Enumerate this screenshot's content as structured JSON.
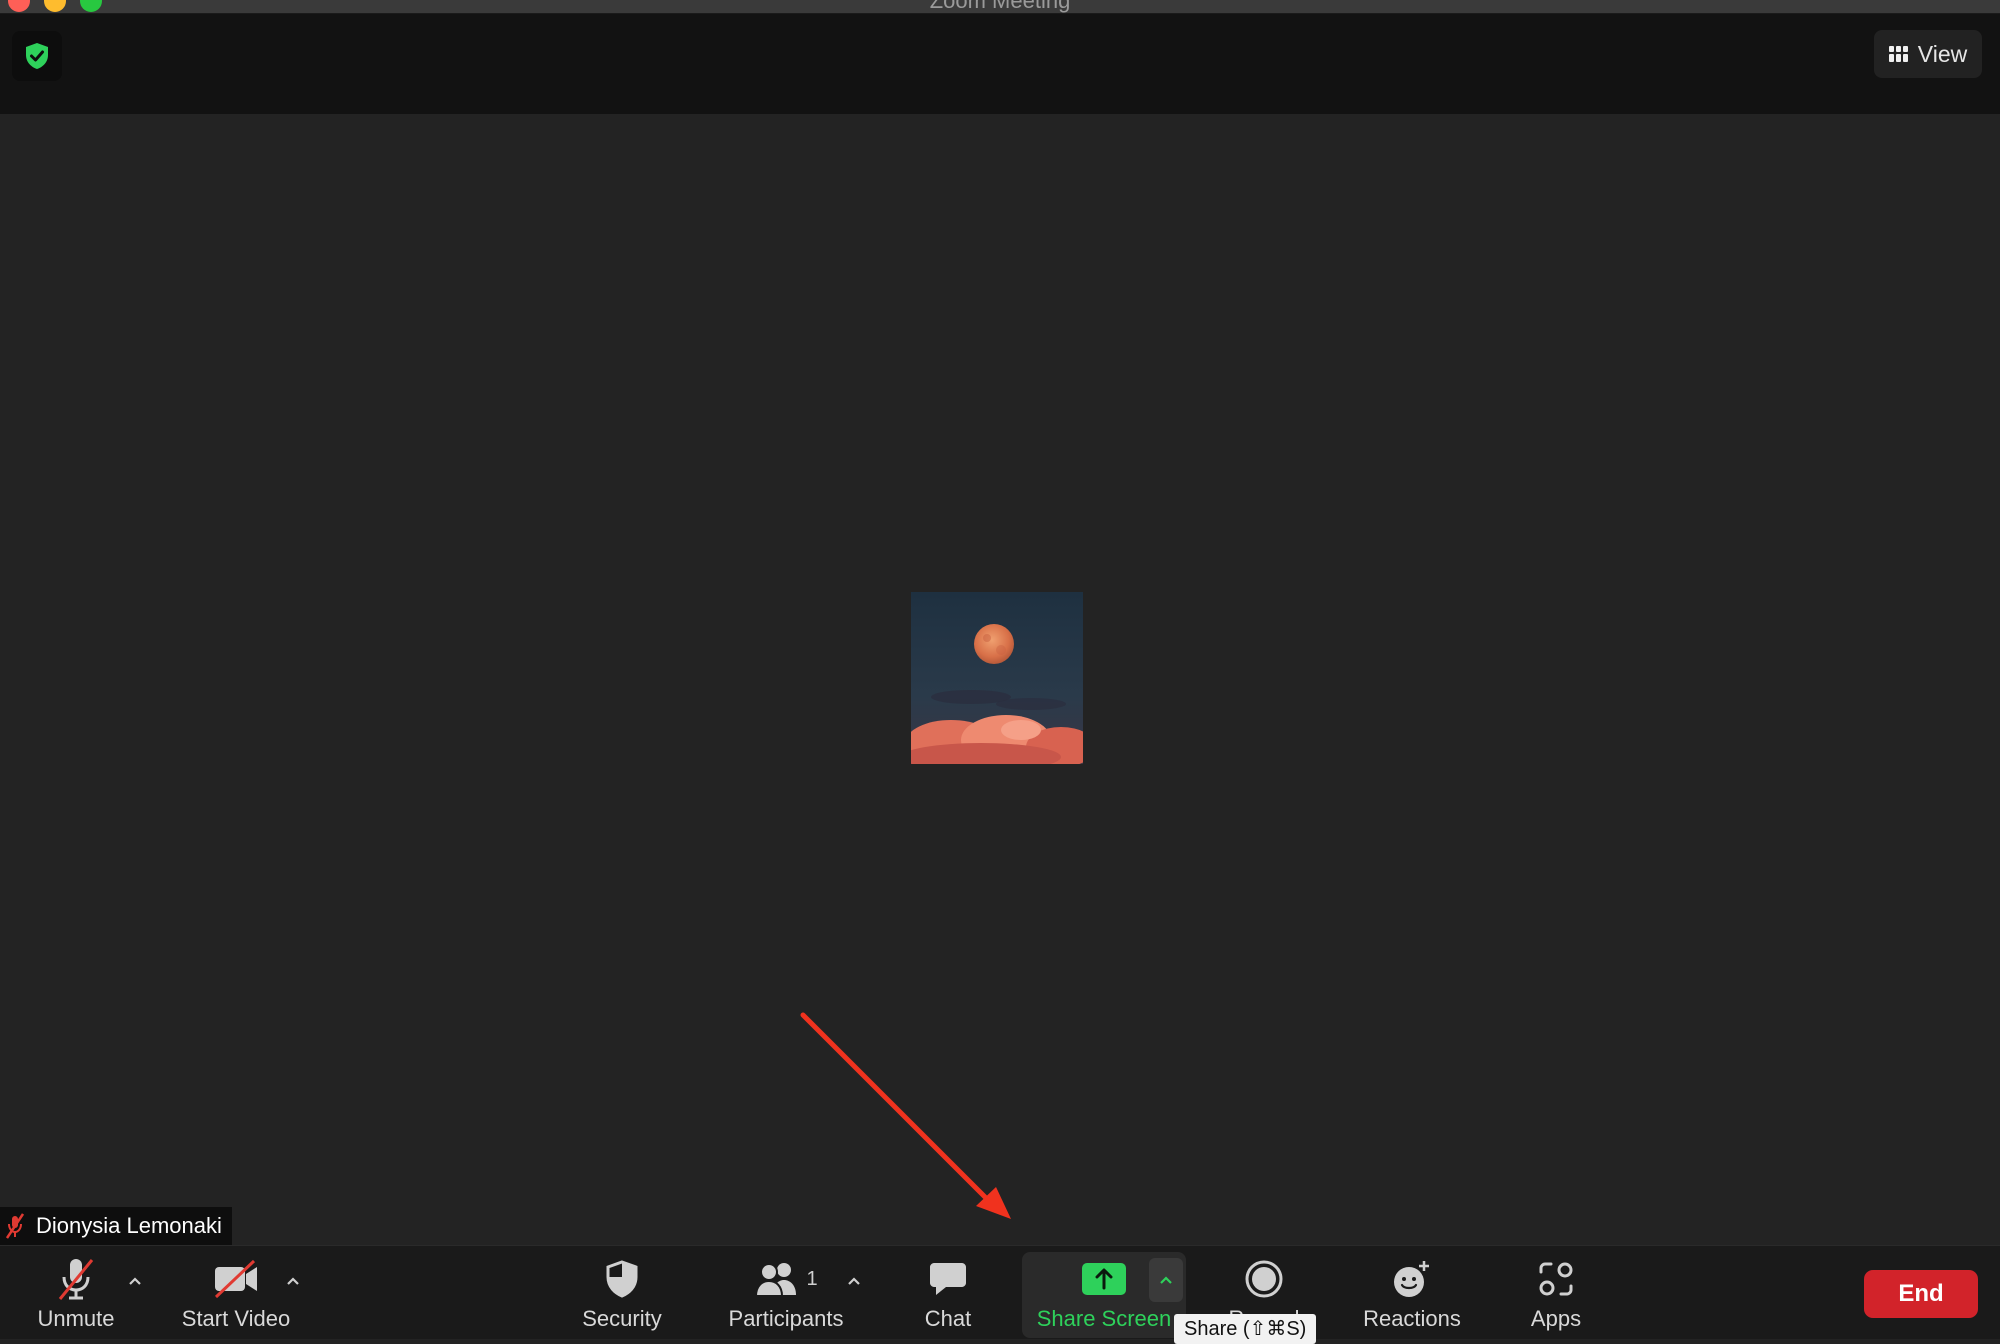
{
  "window": {
    "title": "Zoom Meeting"
  },
  "topbar": {
    "view_label": "View"
  },
  "participant": {
    "name": "Dionysia Lemonaki"
  },
  "toolbar": {
    "unmute_label": "Unmute",
    "start_video_label": "Start Video",
    "security_label": "Security",
    "participants_label": "Participants",
    "participants_count": "1",
    "chat_label": "Chat",
    "share_screen_label": "Share Screen",
    "record_label": "Record",
    "reactions_label": "Reactions",
    "apps_label": "Apps",
    "end_label": "End"
  },
  "tooltip": {
    "text": "Share (⇧⌘S)"
  },
  "colors": {
    "accent_green": "#2ed15b",
    "end_red": "#d2232a",
    "annotation_arrow": "#f0321e"
  },
  "icons": {
    "security_badge": "shield-check-icon",
    "view": "grid-icon",
    "mic": "mic-off-icon",
    "video": "video-off-icon",
    "security": "shield-icon",
    "participants": "people-icon",
    "chat": "chat-bubble-icon",
    "share": "share-up-arrow-icon",
    "record": "record-icon",
    "reactions": "smiley-plus-icon",
    "apps": "apps-icon"
  }
}
